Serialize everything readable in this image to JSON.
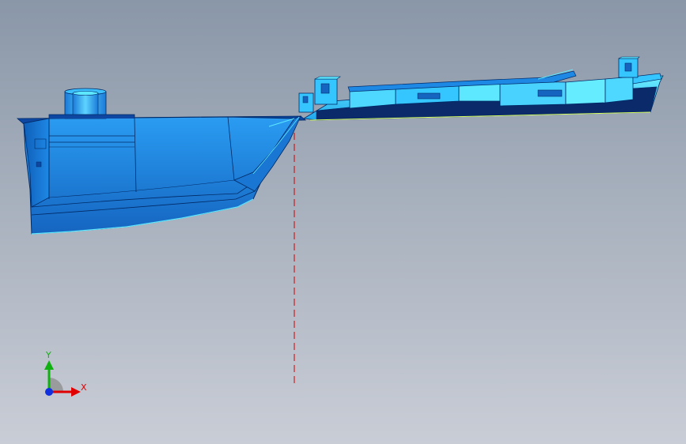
{
  "viewport": {
    "background_top": "#8a97a8",
    "background_bottom": "#c9cdd6"
  },
  "model": {
    "name_icon": "sheet-metal-part-model",
    "body_color": "#1e88e5",
    "face_color": "#2aa8f0",
    "highlight_color": "#5ee8ff",
    "edge_color": "#002a66",
    "section_line_color": "#cc0000"
  },
  "triad": {
    "x_label": "X",
    "y_label": "Y",
    "x_color": "#e00000",
    "y_color": "#10b010",
    "z_color": "#1030e0"
  }
}
